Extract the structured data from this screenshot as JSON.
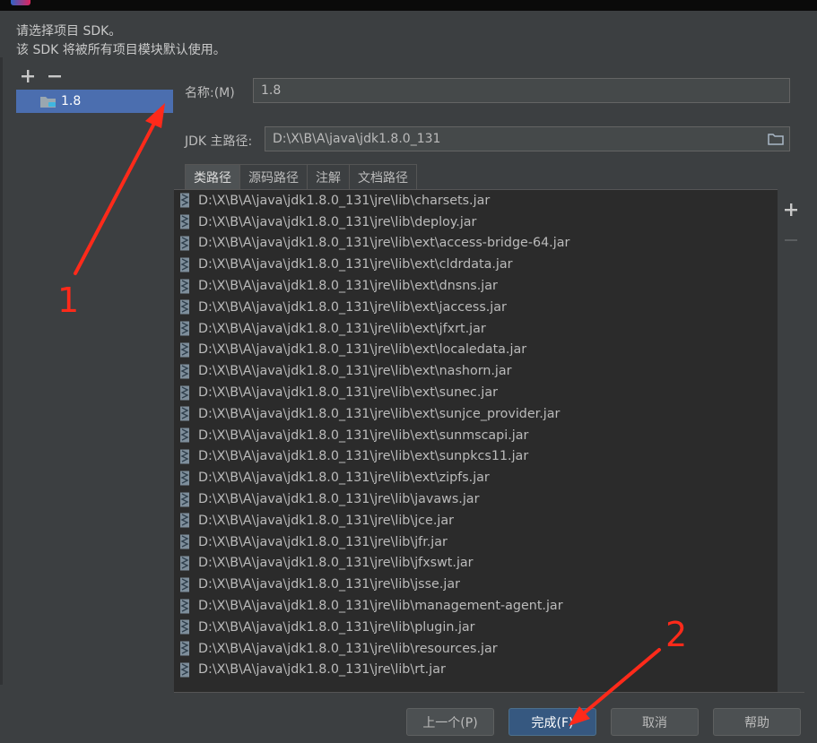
{
  "intro": {
    "line1": "请选择项目 SDK。",
    "line2": "该 SDK 将被所有项目模块默认使用。"
  },
  "sdk_list": {
    "items": [
      {
        "label": "1.8"
      }
    ]
  },
  "form": {
    "name_label": "名称:(M)",
    "name_value": "1.8",
    "home_label": "JDK 主路径:",
    "home_value": "D:\\X\\B\\A\\java\\jdk1.8.0_131"
  },
  "tabs": [
    {
      "label": "类路径"
    },
    {
      "label": "源码路径"
    },
    {
      "label": "注解"
    },
    {
      "label": "文档路径"
    }
  ],
  "classpath": [
    "D:\\X\\B\\A\\java\\jdk1.8.0_131\\jre\\lib\\charsets.jar",
    "D:\\X\\B\\A\\java\\jdk1.8.0_131\\jre\\lib\\deploy.jar",
    "D:\\X\\B\\A\\java\\jdk1.8.0_131\\jre\\lib\\ext\\access-bridge-64.jar",
    "D:\\X\\B\\A\\java\\jdk1.8.0_131\\jre\\lib\\ext\\cldrdata.jar",
    "D:\\X\\B\\A\\java\\jdk1.8.0_131\\jre\\lib\\ext\\dnsns.jar",
    "D:\\X\\B\\A\\java\\jdk1.8.0_131\\jre\\lib\\ext\\jaccess.jar",
    "D:\\X\\B\\A\\java\\jdk1.8.0_131\\jre\\lib\\ext\\jfxrt.jar",
    "D:\\X\\B\\A\\java\\jdk1.8.0_131\\jre\\lib\\ext\\localedata.jar",
    "D:\\X\\B\\A\\java\\jdk1.8.0_131\\jre\\lib\\ext\\nashorn.jar",
    "D:\\X\\B\\A\\java\\jdk1.8.0_131\\jre\\lib\\ext\\sunec.jar",
    "D:\\X\\B\\A\\java\\jdk1.8.0_131\\jre\\lib\\ext\\sunjce_provider.jar",
    "D:\\X\\B\\A\\java\\jdk1.8.0_131\\jre\\lib\\ext\\sunmscapi.jar",
    "D:\\X\\B\\A\\java\\jdk1.8.0_131\\jre\\lib\\ext\\sunpkcs11.jar",
    "D:\\X\\B\\A\\java\\jdk1.8.0_131\\jre\\lib\\ext\\zipfs.jar",
    "D:\\X\\B\\A\\java\\jdk1.8.0_131\\jre\\lib\\javaws.jar",
    "D:\\X\\B\\A\\java\\jdk1.8.0_131\\jre\\lib\\jce.jar",
    "D:\\X\\B\\A\\java\\jdk1.8.0_131\\jre\\lib\\jfr.jar",
    "D:\\X\\B\\A\\java\\jdk1.8.0_131\\jre\\lib\\jfxswt.jar",
    "D:\\X\\B\\A\\java\\jdk1.8.0_131\\jre\\lib\\jsse.jar",
    "D:\\X\\B\\A\\java\\jdk1.8.0_131\\jre\\lib\\management-agent.jar",
    "D:\\X\\B\\A\\java\\jdk1.8.0_131\\jre\\lib\\plugin.jar",
    "D:\\X\\B\\A\\java\\jdk1.8.0_131\\jre\\lib\\resources.jar",
    "D:\\X\\B\\A\\java\\jdk1.8.0_131\\jre\\lib\\rt.jar"
  ],
  "toolbar": {
    "add_icon": "plus-icon",
    "remove_icon": "minus-icon"
  },
  "buttons": {
    "previous": "上一个(P)",
    "finish": "完成(F)",
    "cancel": "取消",
    "help": "帮助"
  },
  "annotations": {
    "label1": "1",
    "label2": "2"
  },
  "colors": {
    "background": "#3c3f41",
    "list_background": "#2b2b2b",
    "selection": "#4b6eaf",
    "primary_button": "#365880",
    "annotation": "#ff2a1a"
  }
}
